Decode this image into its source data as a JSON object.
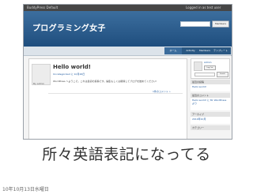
{
  "screenshot": {
    "admin_bar": {
      "left": "BuddyPress Default",
      "right": "Logged in as test user"
    },
    "site_title": "プログラミング女子",
    "header_search": {
      "button": "Members"
    },
    "nav": {
      "home": "ホーム",
      "activity": "Activity",
      "members": "Members",
      "templates": "テンプレート"
    },
    "post": {
      "author": "By admin",
      "title": "Hello world!",
      "meta": "Uncategorized に 10月26日",
      "excerpt": "WordPress へようこそ。これは最初の投稿です。編集もしくは削除してブログを始めてください!",
      "comments": "1件のコメント »"
    },
    "sidebar": {
      "login_name": "Admin",
      "logout": "Log Out",
      "search_button": "Search",
      "recent_posts_title": "最近の投稿",
      "recent_posts_item": "Hello world!",
      "recent_comments_title": "最近のコメント",
      "recent_comments_item": "Hello world! に Mr WordPress より",
      "archives_title": "アーカイブ",
      "archives_item": "2010年10月",
      "categories_title": "カテゴリー"
    }
  },
  "caption": "所々英語表記になってる",
  "slide_date": "10年10月13日水曜日"
}
